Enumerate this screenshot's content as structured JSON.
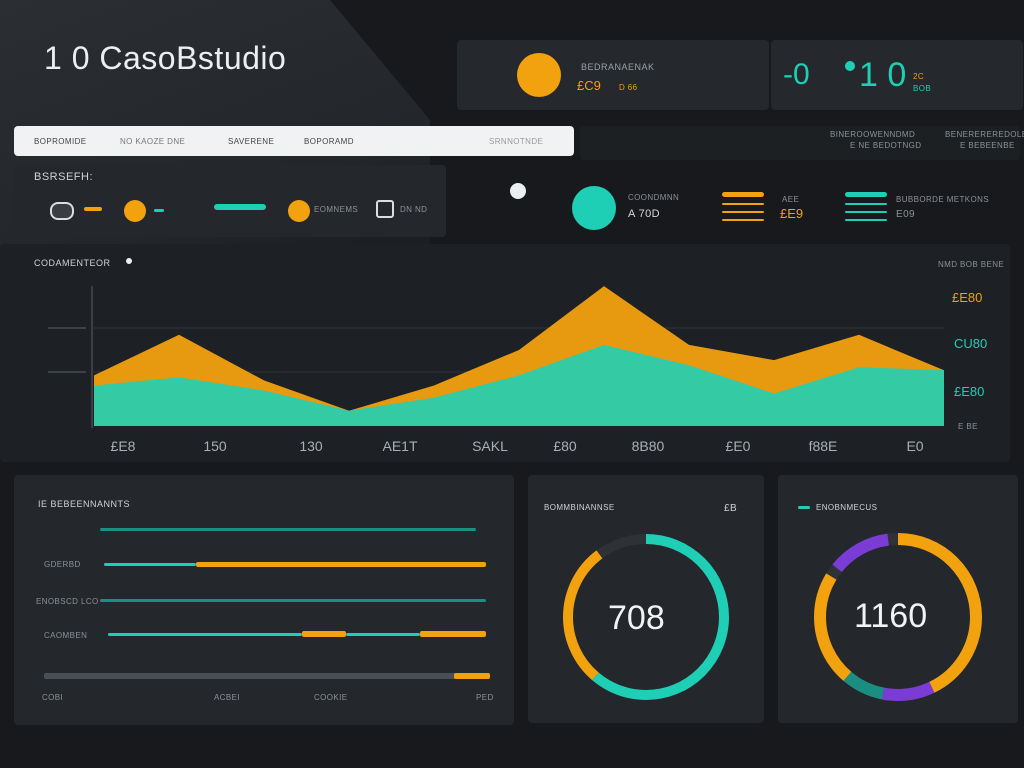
{
  "app": {
    "title": "1 0 CasoBstudio"
  },
  "top_cards": {
    "card1": {
      "heading": "BEDRANAENAK",
      "value": "£C9",
      "sub": "D 66"
    },
    "card2": {
      "left_value": "-0",
      "right_value": "1 0",
      "sub_top": "2C",
      "sub_bottom": "BOB"
    }
  },
  "search_bar": {
    "items": [
      "BOPROMIDE",
      "NO KAOZE DNE",
      "SAVERENE",
      "BOPORAMD"
    ],
    "right_label": "SRNNOTNDE"
  },
  "header_right": {
    "line1a": "BINEROOWENNDMD",
    "line1b": "BENEREREREDOLE",
    "line2a": "E NE BEDOTNGD",
    "line2b": "E BEBEENBE"
  },
  "toolbar": {
    "title": "BSRSEFH:",
    "items": [
      "",
      "",
      "EOMNEMS",
      "DN ND"
    ]
  },
  "stats": {
    "stat1": {
      "label": "COONDMNN",
      "value": "A 70D"
    },
    "stat2": {
      "label": "AEE",
      "value": "£E9"
    },
    "stat3": {
      "label": "BUBBORDE METKONS",
      "value": "E09"
    }
  },
  "chart_section": {
    "title": "CODAMENTEOR",
    "top_right": "NMD BOB BENE",
    "right_labels": [
      "£E80",
      "CU80",
      "£E80"
    ],
    "bottom_right": "E BE"
  },
  "chart_data": {
    "type": "area",
    "x": [
      "£E8",
      "150",
      "130",
      "AE1T",
      "SAKL",
      "£80",
      "8B80",
      "£E0",
      "f88E",
      "E0"
    ],
    "series": [
      {
        "values": [
          50,
          90,
          45,
          15,
          40,
          75,
          138,
          80,
          65,
          90,
          55
        ]
      },
      {
        "values": [
          40,
          48,
          35,
          15,
          28,
          50,
          80,
          60,
          32,
          58,
          55
        ]
      }
    ],
    "colors": [
      "#f2a10f",
      "#1fcfb5"
    ],
    "ylim": [
      0,
      150
    ],
    "grid": true,
    "legend": "none"
  },
  "progress_panel": {
    "title": "IE BEBEENNANNTS",
    "rows": [
      "",
      "GDERBD",
      "ENOBSCD LCO",
      "CAOMBEN"
    ],
    "footer": [
      "COBI",
      "ACBEI",
      "COOKIE",
      "PED"
    ]
  },
  "gauge1": {
    "title": "BOMMBINANNSE",
    "badge": "£B",
    "value": "708"
  },
  "gauge2": {
    "title": "ENOBNMECUS",
    "value": "1160"
  },
  "colors": {
    "accent_teal": "#1fcfb5",
    "accent_orange": "#f2a10f",
    "accent_purple": "#7b3cd6"
  }
}
